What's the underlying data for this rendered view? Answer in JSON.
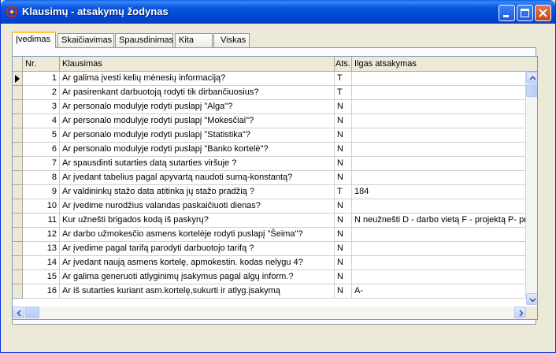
{
  "window": {
    "title": "Klausimų - atsakymų žodynas"
  },
  "tabs": [
    "Įvedimas",
    "Skaičiavimas",
    "Spausdinimas",
    "Kita",
    "Viskas"
  ],
  "columns": {
    "nr": "Nr.",
    "question": "Klausimas",
    "answer": "Ats.",
    "long_answer": "Ilgas atsakymas"
  },
  "rows": [
    {
      "nr": "1",
      "q": "Ar galima įvesti kelių mėnesių informaciją?",
      "a": "T",
      "l": ""
    },
    {
      "nr": "2",
      "q": "Ar pasirenkant darbuotoją rodyti tik dirbančiuosius?",
      "a": "T",
      "l": ""
    },
    {
      "nr": "3",
      "q": "Ar personalo modulyje rodyti puslapį \"Alga\"?",
      "a": "N",
      "l": ""
    },
    {
      "nr": "4",
      "q": "Ar personalo modulyje rodyti puslapį \"Mokesčiai\"?",
      "a": "N",
      "l": ""
    },
    {
      "nr": "5",
      "q": "Ar personalo modulyje rodyti puslapį \"Statistika\"?",
      "a": "N",
      "l": ""
    },
    {
      "nr": "6",
      "q": "Ar personalo modulyje rodyti puslapį \"Banko kortelė\"?",
      "a": "N",
      "l": ""
    },
    {
      "nr": "7",
      "q": "Ar spausdinti sutarties datą sutarties viršuje ?",
      "a": "N",
      "l": ""
    },
    {
      "nr": "8",
      "q": "Ar įvedant tabelius pagal apyvartą naudoti sumą-konstantą?",
      "a": "N",
      "l": ""
    },
    {
      "nr": "9",
      "q": "Ar valdininkų stažo data atitinka jų stažo pradžią ?",
      "a": "T",
      "l": "184"
    },
    {
      "nr": "10",
      "q": "Ar įvedime nurodžius valandas paskaičiuoti dienas?",
      "a": "N",
      "l": ""
    },
    {
      "nr": "11",
      "q": "Kur užnešti brigados kodą iš paskyrų?",
      "a": "N",
      "l": "N neužnešti D - darbo vietą F - projektą P- prie"
    },
    {
      "nr": "12",
      "q": "Ar darbo užmokesčio asmens kortelėje rodyti puslapį \"Šeima\"?",
      "a": "N",
      "l": ""
    },
    {
      "nr": "13",
      "q": "Ar įvedime pagal tarifą parodyti darbuotojo tarifą ?",
      "a": "N",
      "l": ""
    },
    {
      "nr": "14",
      "q": "Ar įvedant naują asmens kortelę, apmokestin. kodas nelygu 4?",
      "a": "N",
      "l": ""
    },
    {
      "nr": "15",
      "q": "Ar galima generuoti atlyginimų įsakymus pagal algų inform.?",
      "a": "N",
      "l": ""
    },
    {
      "nr": "16",
      "q": "Ar iš sutarties kuriant asm.kortelę,sukurti ir atlyg.įsakymą",
      "a": "N",
      "l": "A-"
    }
  ]
}
